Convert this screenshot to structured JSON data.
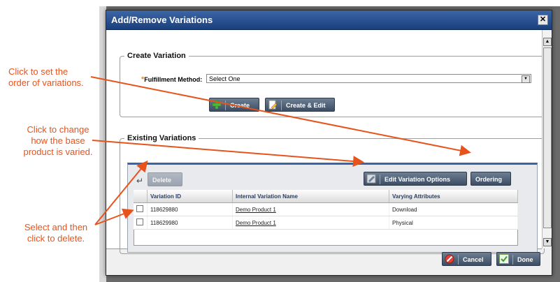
{
  "modal": {
    "title": "Add/Remove Variations",
    "close_glyph": "✕"
  },
  "create_section": {
    "legend": "Create Variation",
    "fulfillment_label": "Fulfillment Method:",
    "required_mark": "*",
    "select_value": "Select One",
    "create_button": "Create",
    "create_edit_button": "Create & Edit"
  },
  "existing_section": {
    "legend": "Existing Variations",
    "delete_button": "Delete",
    "edit_options_button": "Edit Variation Options",
    "ordering_button": "Ordering",
    "columns": [
      "Variation ID",
      "Internal Variation Name",
      "Varying Attributes"
    ],
    "rows": [
      {
        "id": "118629880",
        "name": "Demo Product 1",
        "attributes": "Download"
      },
      {
        "id": "118629980",
        "name": "Demo Product 1",
        "attributes": "Physical"
      }
    ]
  },
  "footer": {
    "cancel_button": "Cancel",
    "done_button": "Done"
  },
  "annotations": {
    "order_line1": "Click to set the",
    "order_line2": "order of variations.",
    "vary_line1": "Click to change",
    "vary_line2": "how the base",
    "vary_line3": "product is varied.",
    "delete_line1": "Select and then",
    "delete_line2": "click to delete."
  },
  "colors": {
    "annotation": "#e8531c",
    "titlebar": "#2b5293",
    "button": "#4d5e74"
  },
  "icons": {
    "create": "plus-icon",
    "create_edit": "edit-document-icon",
    "delete": "down-arrow-icon",
    "edit_options": "edit-options-icon",
    "cancel": "cancel-icon",
    "done": "check-icon"
  }
}
